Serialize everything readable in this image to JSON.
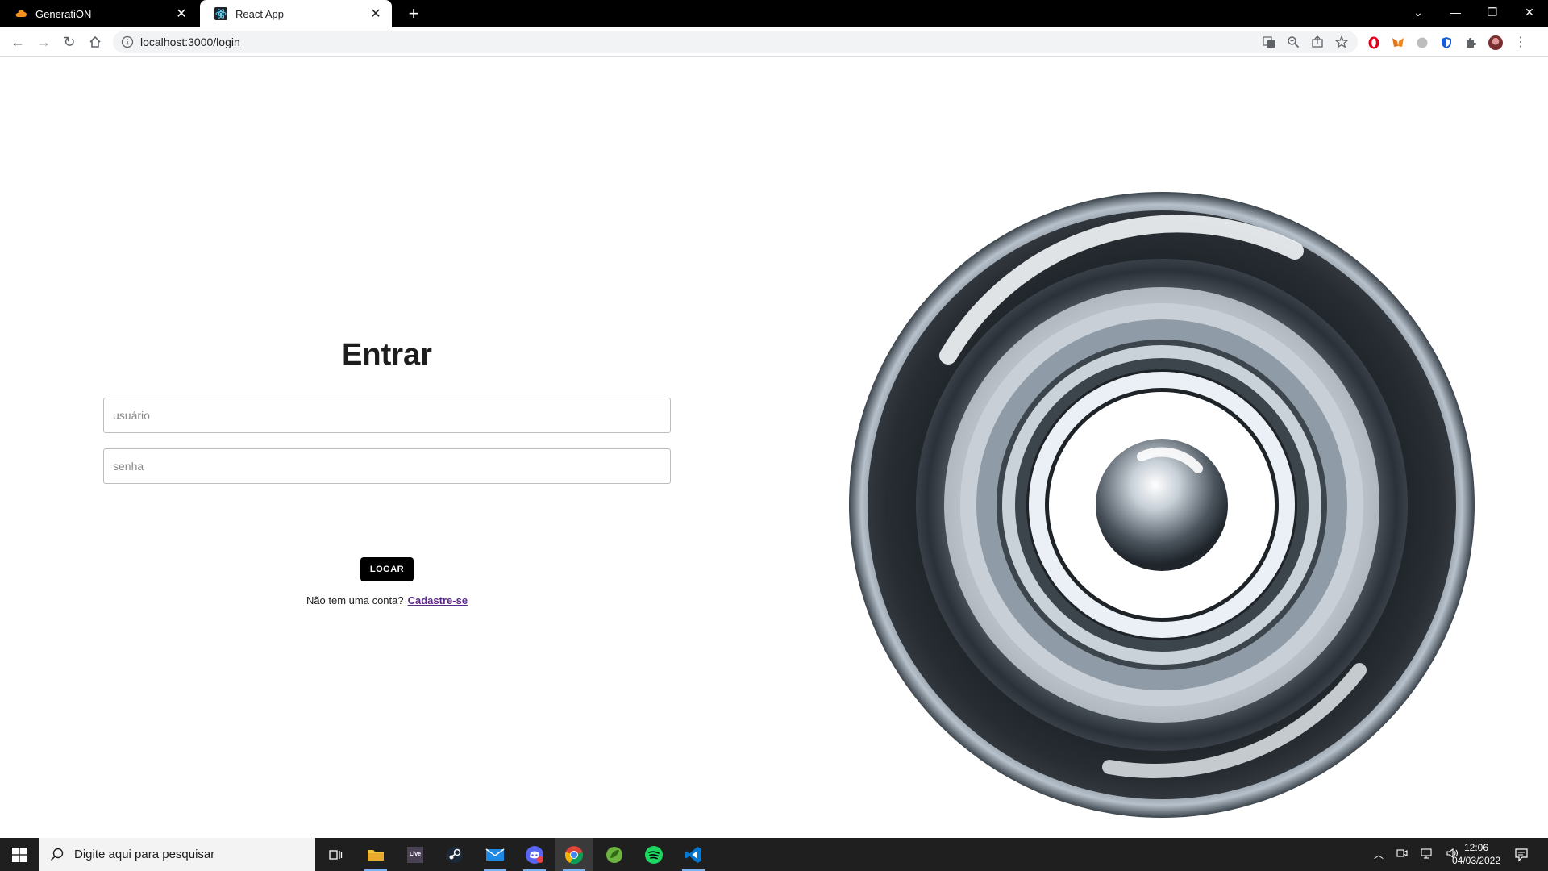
{
  "browser": {
    "tabs": [
      {
        "title": "GeneratiON",
        "active": false,
        "favicon": "cloud-icon"
      },
      {
        "title": "React App",
        "active": true,
        "favicon": "react-icon"
      }
    ],
    "address": "localhost:3000/login"
  },
  "login": {
    "title": "Entrar",
    "username_placeholder": "usuário",
    "password_placeholder": "senha",
    "submit_label": "LOGAR",
    "signup_prompt": "Não tem uma conta?",
    "signup_link": "Cadastre-se"
  },
  "taskbar": {
    "search_placeholder": "Digite aqui para pesquisar",
    "live_label": "Live",
    "time": "12:06",
    "date": "04/03/2022"
  },
  "colors": {
    "button_bg": "#000000",
    "link": "#5b2b8a",
    "taskbar_bg": "#1f1f1f"
  }
}
